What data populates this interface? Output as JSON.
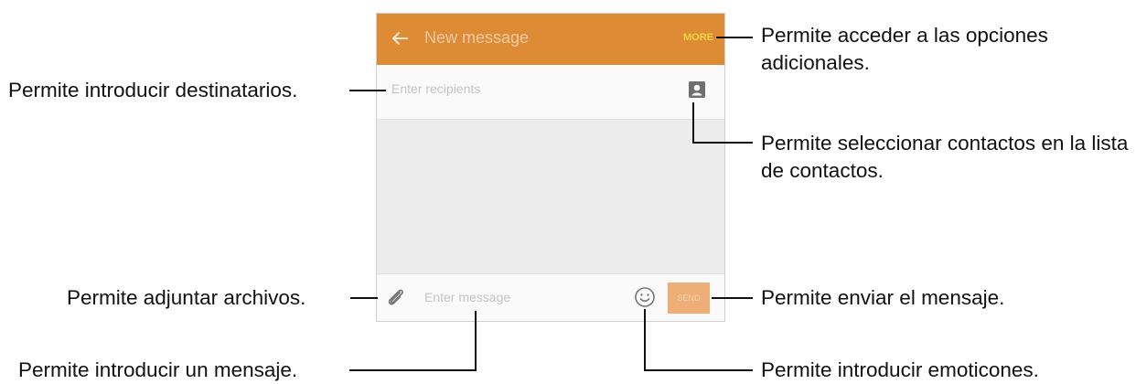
{
  "colors": {
    "appbar": "#de8b36",
    "send_button": "#eeae77"
  },
  "appbar": {
    "title": "New message",
    "more_label": "MORE",
    "back_icon": "arrow-left-icon"
  },
  "recipient": {
    "placeholder": "Enter recipients",
    "contact_icon": "contact-card-icon"
  },
  "composer": {
    "placeholder": "Enter message",
    "attach_icon": "paperclip-icon",
    "emoji_icon": "smiley-icon",
    "send_label": "SEND"
  },
  "callouts": {
    "more": "Permite acceder a las opciones adicionales.",
    "recipients": "Permite introducir destinatarios.",
    "contacts": "Permite seleccionar contactos en la lista de contactos.",
    "attach": "Permite adjuntar archivos.",
    "send": "Permite enviar el mensaje.",
    "message": "Permite introducir un mensaje.",
    "emoji": "Permite introducir emoticones."
  }
}
